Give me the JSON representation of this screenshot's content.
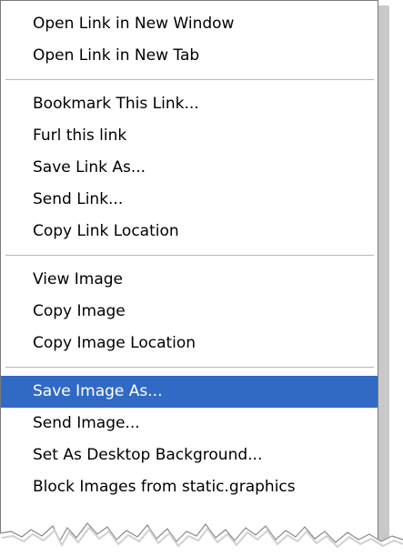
{
  "menu": {
    "groups": [
      {
        "items": [
          {
            "label": "Open Link in New Window"
          },
          {
            "label": "Open Link in New Tab"
          }
        ]
      },
      {
        "items": [
          {
            "label": "Bookmark This Link..."
          },
          {
            "label": "Furl this link"
          },
          {
            "label": "Save Link As..."
          },
          {
            "label": "Send Link..."
          },
          {
            "label": "Copy Link Location"
          }
        ]
      },
      {
        "items": [
          {
            "label": "View Image"
          },
          {
            "label": "Copy Image"
          },
          {
            "label": "Copy Image Location"
          }
        ]
      },
      {
        "items": [
          {
            "label": "Save Image As...",
            "highlighted": true
          },
          {
            "label": "Send Image..."
          },
          {
            "label": "Set As Desktop Background..."
          },
          {
            "label": "Block Images from static.graphics"
          }
        ]
      }
    ]
  },
  "colors": {
    "highlight": "#316ac5",
    "highlight_text": "#ffffff",
    "menu_background": "#ffffff",
    "separator": "#b7b7b7"
  }
}
